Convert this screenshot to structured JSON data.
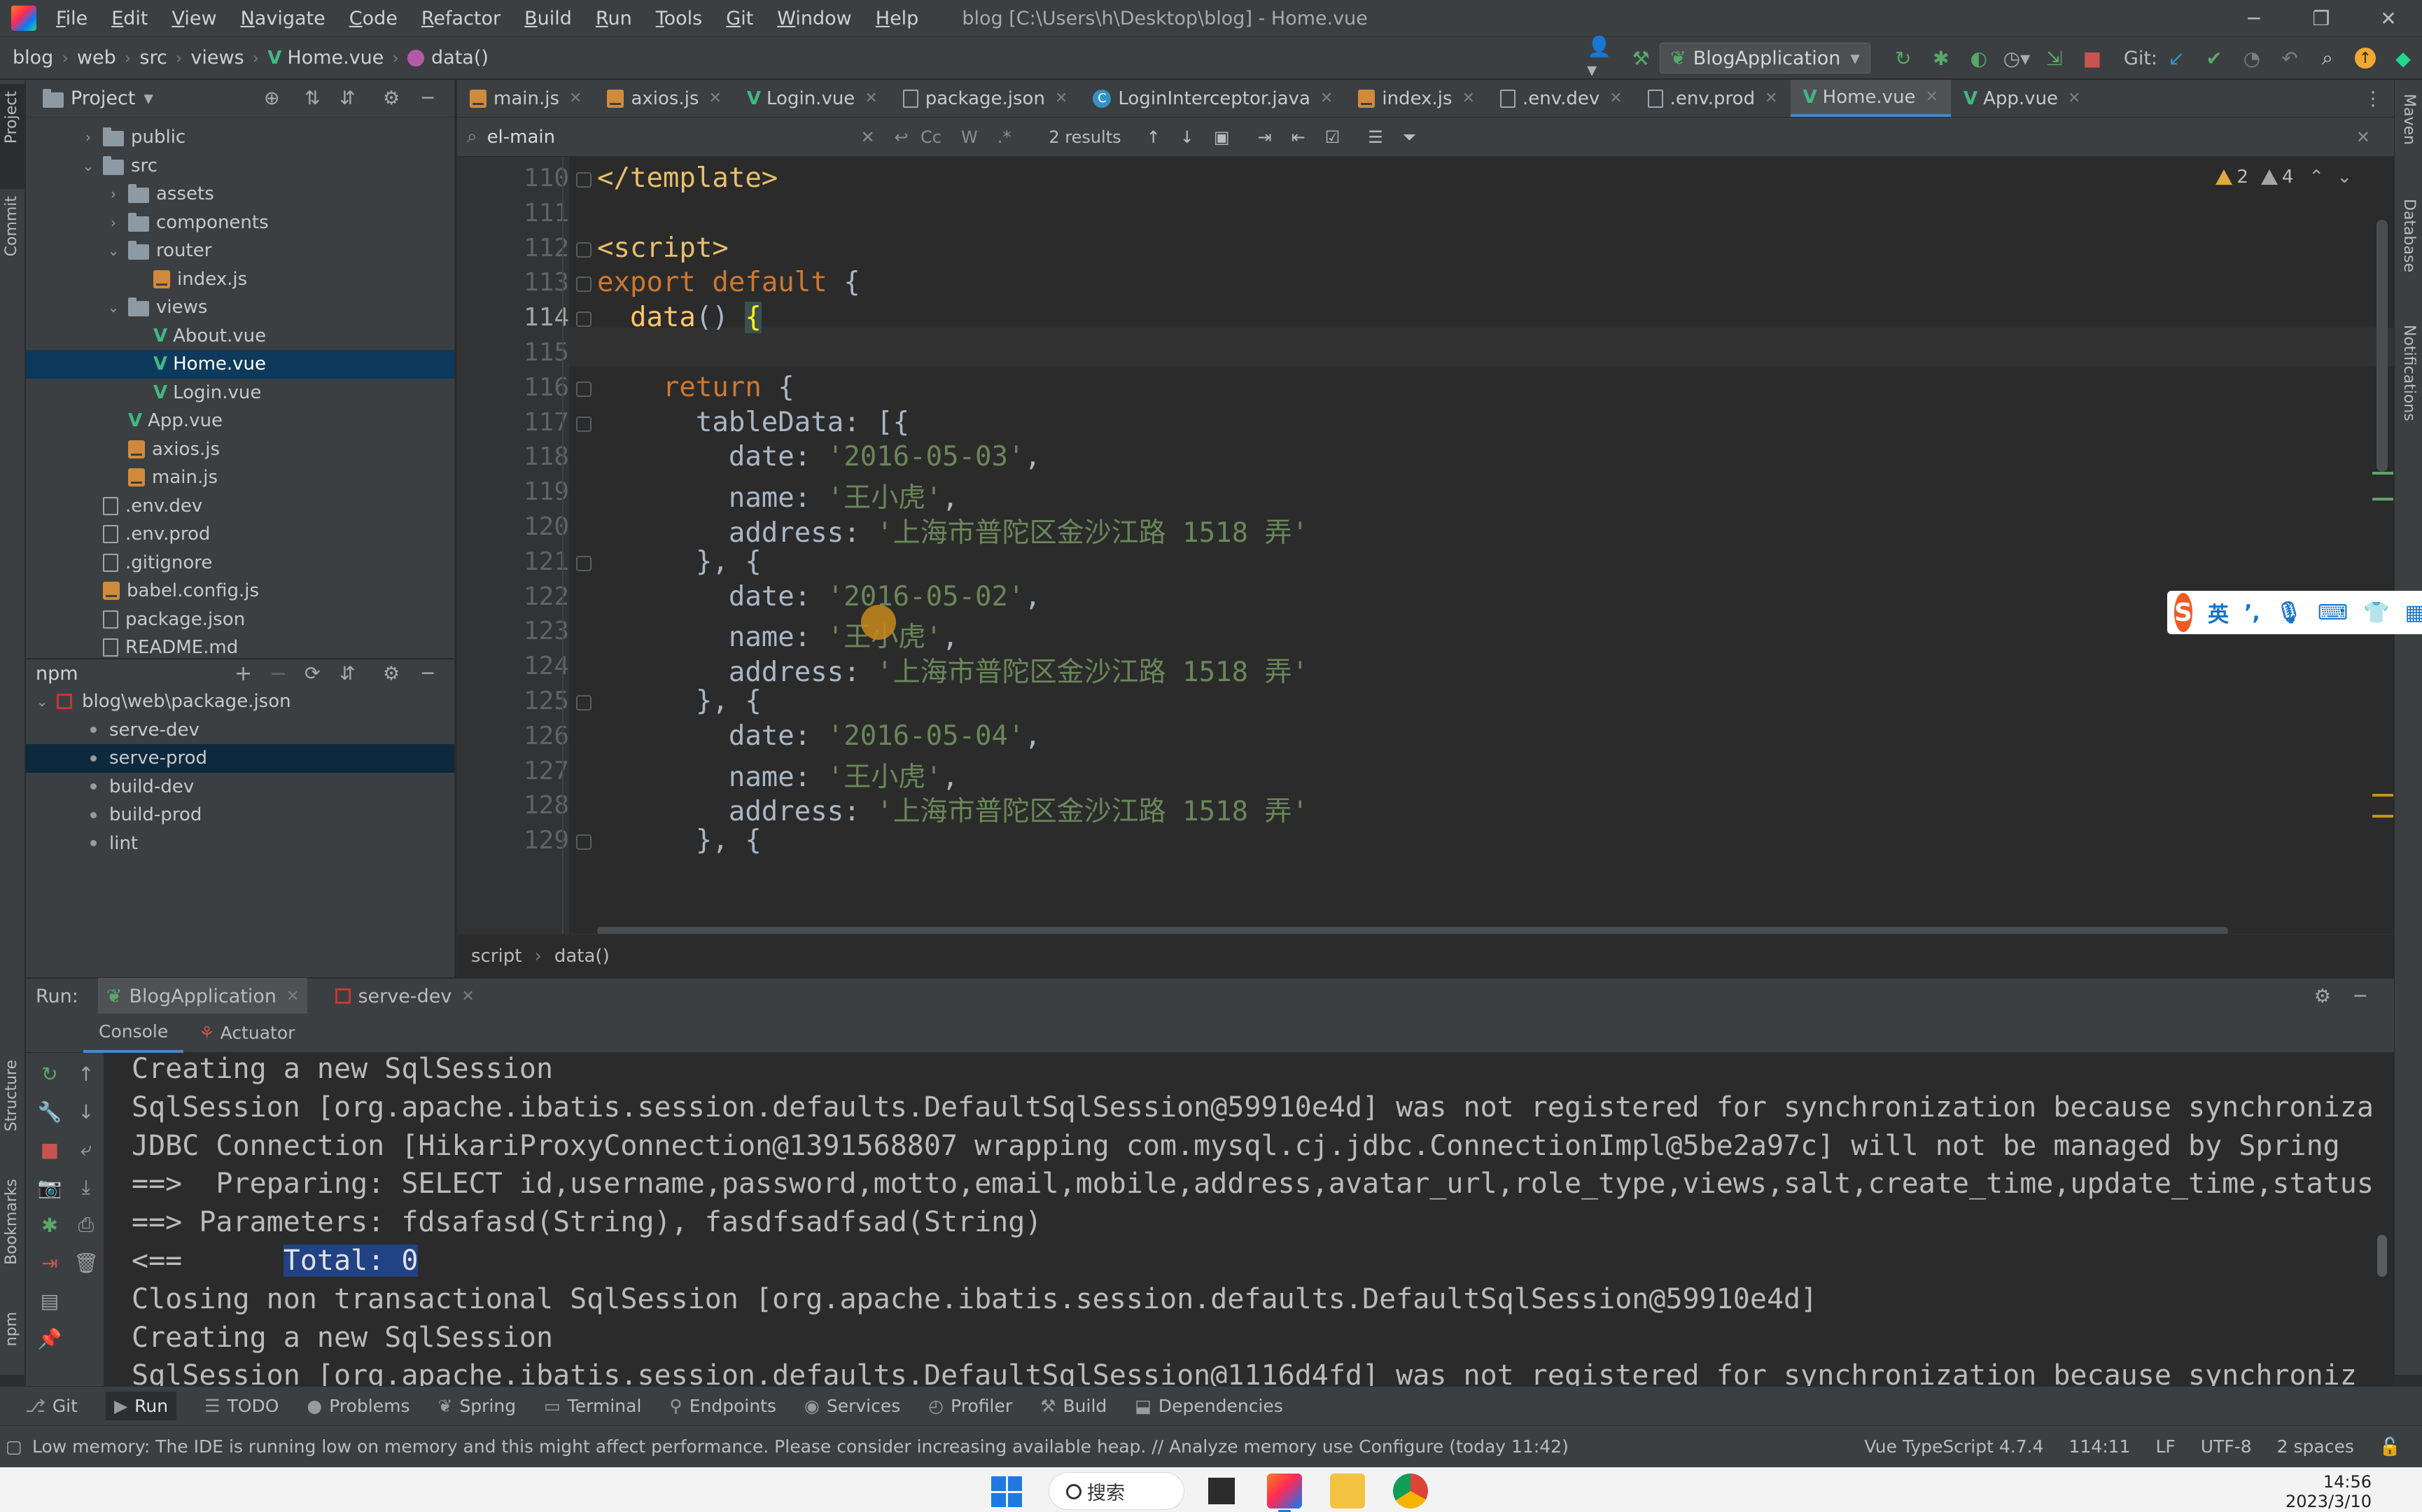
{
  "menubar": {
    "items": [
      "File",
      "Edit",
      "View",
      "Navigate",
      "Code",
      "Refactor",
      "Build",
      "Run",
      "Tools",
      "Git",
      "Window",
      "Help"
    ],
    "window_title": "blog [C:\\Users\\h\\Desktop\\blog] - Home.vue"
  },
  "navbar": {
    "crumbs": [
      "blog",
      "web",
      "src",
      "views",
      "Home.vue",
      "data()"
    ],
    "run_config": "BlogApplication",
    "git_label": "Git:"
  },
  "project_panel": {
    "title": "Project",
    "tree": [
      {
        "label": "public",
        "type": "folder",
        "indent": 1,
        "expanded": false
      },
      {
        "label": "src",
        "type": "folder",
        "indent": 1,
        "expanded": true
      },
      {
        "label": "assets",
        "type": "folder",
        "indent": 2,
        "expanded": false
      },
      {
        "label": "components",
        "type": "folder",
        "indent": 2,
        "expanded": false
      },
      {
        "label": "router",
        "type": "folder",
        "indent": 2,
        "expanded": true
      },
      {
        "label": "index.js",
        "type": "js",
        "indent": 3
      },
      {
        "label": "views",
        "type": "folder",
        "indent": 2,
        "expanded": true
      },
      {
        "label": "About.vue",
        "type": "vue",
        "indent": 3
      },
      {
        "label": "Home.vue",
        "type": "vue",
        "indent": 3,
        "selected": true
      },
      {
        "label": "Login.vue",
        "type": "vue",
        "indent": 3
      },
      {
        "label": "App.vue",
        "type": "vue",
        "indent": 2
      },
      {
        "label": "axios.js",
        "type": "js",
        "indent": 2
      },
      {
        "label": "main.js",
        "type": "js",
        "indent": 2
      },
      {
        "label": ".env.dev",
        "type": "file",
        "indent": 1
      },
      {
        "label": ".env.prod",
        "type": "file",
        "indent": 1
      },
      {
        "label": ".gitignore",
        "type": "file",
        "indent": 1
      },
      {
        "label": "babel.config.js",
        "type": "js",
        "indent": 1
      },
      {
        "label": "package.json",
        "type": "file",
        "indent": 1
      },
      {
        "label": "README.md",
        "type": "file",
        "indent": 1
      }
    ]
  },
  "npm_panel": {
    "title": "npm",
    "package": "blog\\web\\package.json",
    "scripts": [
      "serve-dev",
      "serve-prod",
      "build-dev",
      "build-prod",
      "lint"
    ],
    "selected_script": "serve-prod"
  },
  "editor_tabs": [
    {
      "label": "main.js",
      "type": "js"
    },
    {
      "label": "axios.js",
      "type": "js"
    },
    {
      "label": "Login.vue",
      "type": "vue"
    },
    {
      "label": "package.json",
      "type": "file"
    },
    {
      "label": "LoginInterceptor.java",
      "type": "java"
    },
    {
      "label": "index.js",
      "type": "js"
    },
    {
      "label": ".env.dev",
      "type": "file"
    },
    {
      "label": ".env.prod",
      "type": "file"
    },
    {
      "label": "Home.vue",
      "type": "vue",
      "active": true
    },
    {
      "label": "App.vue",
      "type": "vue"
    }
  ],
  "findbar": {
    "query": "el-main",
    "results": "2 results",
    "opt_case": "Cc",
    "opt_word": "W",
    "opt_regex": ".*"
  },
  "inspections": {
    "warnings": "2",
    "weak_warnings": "4"
  },
  "editor": {
    "current_line": "114",
    "lines": [
      {
        "n": "110",
        "code": "</template>"
      },
      {
        "n": "111",
        "code": ""
      },
      {
        "n": "112",
        "code": "<script>"
      },
      {
        "n": "113",
        "code": "export default {"
      },
      {
        "n": "114",
        "code": "  data() {"
      },
      {
        "n": "115",
        "code": ""
      },
      {
        "n": "116",
        "code": "    return {"
      },
      {
        "n": "117",
        "code": "      tableData: [{"
      },
      {
        "n": "118",
        "code": "        date: '2016-05-03',"
      },
      {
        "n": "119",
        "code": "        name: '王小虎',"
      },
      {
        "n": "120",
        "code": "        address: '上海市普陀区金沙江路 1518 弄'"
      },
      {
        "n": "121",
        "code": "      }, {"
      },
      {
        "n": "122",
        "code": "        date: '2016-05-02',"
      },
      {
        "n": "123",
        "code": "        name: '王小虎',"
      },
      {
        "n": "124",
        "code": "        address: '上海市普陀区金沙江路 1518 弄'"
      },
      {
        "n": "125",
        "code": "      }, {"
      },
      {
        "n": "126",
        "code": "        date: '2016-05-04',"
      },
      {
        "n": "127",
        "code": "        name: '王小虎',"
      },
      {
        "n": "128",
        "code": "        address: '上海市普陀区金沙江路 1518 弄'"
      },
      {
        "n": "129",
        "code": "      }, {"
      }
    ],
    "breadcrumb": [
      "script",
      "data()"
    ]
  },
  "ime": {
    "lang": "英"
  },
  "run_panel": {
    "label": "Run:",
    "tabs": [
      "BlogApplication",
      "serve-dev"
    ],
    "subtabs": [
      "Console",
      "Actuator"
    ],
    "console": [
      "Creating a new SqlSession",
      "SqlSession [org.apache.ibatis.session.defaults.DefaultSqlSession@59910e4d] was not registered for synchronization because synchroniza",
      "JDBC Connection [HikariProxyConnection@1391568807 wrapping com.mysql.cj.jdbc.ConnectionImpl@5be2a97c] will not be managed by Spring",
      "==>  Preparing: SELECT id,username,password,motto,email,mobile,address,avatar_url,role_type,views,salt,create_time,update_time,status",
      "==> Parameters: fdsafasd(String), fasdfsadfsad(String)",
      "<==      ",
      "Closing non transactional SqlSession [org.apache.ibatis.session.defaults.DefaultSqlSession@59910e4d]",
      "Creating a new SqlSession",
      "SqlSession [org.apache.ibatis.session.defaults.DefaultSqlSession@1116d4fd] was not registered for synchronization because synchroniz"
    ],
    "total_highlight": "Total: 0"
  },
  "tool_windows": [
    "Git",
    "Run",
    "TODO",
    "Problems",
    "Spring",
    "Terminal",
    "Endpoints",
    "Services",
    "Profiler",
    "Build",
    "Dependencies"
  ],
  "left_strip": [
    "Project",
    "Commit",
    "Structure",
    "Bookmarks",
    "npm"
  ],
  "right_strip": [
    "Maven",
    "Database",
    "Notifications"
  ],
  "statusbar": {
    "message": "Low memory: The IDE is running low on memory and this might affect performance. Please consider increasing available heap. // Analyze memory use   Configure (today 11:42)",
    "lang": "Vue TypeScript 4.7.4",
    "position": "114:11",
    "line_sep": "LF",
    "encoding": "UTF-8",
    "indent": "2 spaces"
  },
  "taskbar": {
    "search": "搜索",
    "time": "14:56",
    "date": "2023/3/10"
  },
  "colors": {
    "accent": "#4a88c7",
    "keyword": "#cc7832",
    "string": "#6a8759",
    "tag": "#e8bf6a",
    "selection": "#0d293e"
  }
}
